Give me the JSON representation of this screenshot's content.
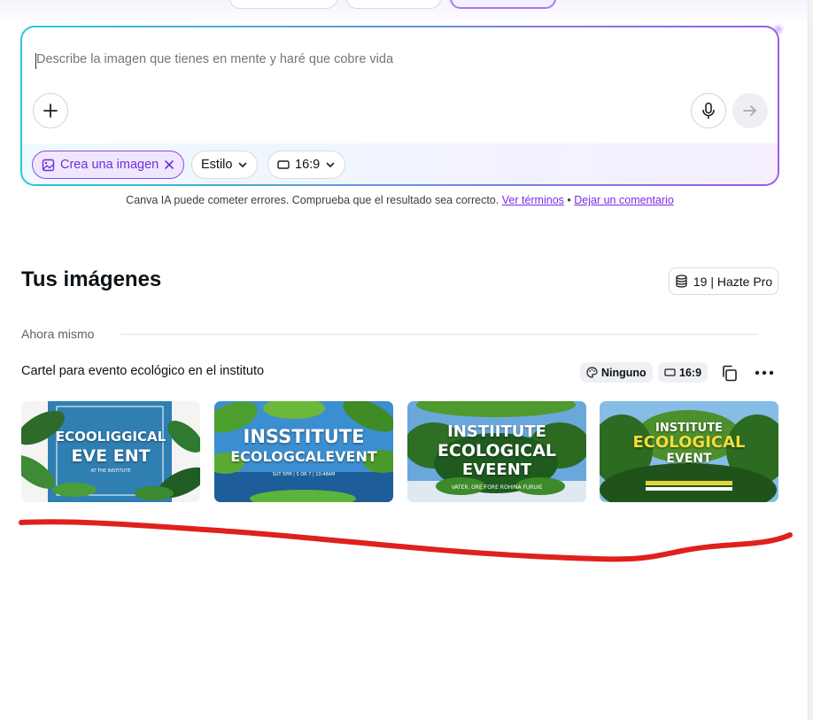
{
  "prompt": {
    "placeholder": "Describe la imagen que tienes en mente y haré que cobre vida",
    "chips": {
      "mode": "Crea una imagen",
      "style": "Estilo",
      "ratio": "16:9"
    }
  },
  "disclaimer": {
    "text": "Canva IA puede cometer errores. Comprueba que el resultado sea correcto.",
    "terms_link": "Ver términos",
    "separator": "•",
    "feedback_link": "Dejar un comentario"
  },
  "images_section": {
    "title": "Tus imágenes",
    "credits": "19 | Hazte Pro",
    "time_label": "Ahora mismo",
    "prompt_text": "Cartel para evento ecológico en el instituto",
    "style_tag": "Ninguno",
    "ratio_tag": "16:9",
    "thumbnails": [
      {
        "title_lines": [
          "ECOOLIGGICAL",
          "EVE ENT"
        ],
        "sub": "AT THE INSTITUTE"
      },
      {
        "title_lines": [
          "INSSTITUTE",
          "ECOLOGCALEVENT"
        ],
        "sub": "SUT 5PM | 5 OR 7 | 10:48AM"
      },
      {
        "title_lines": [
          "INSTIITUTE",
          "ECOLOGICAL",
          "EVEENT"
        ],
        "sub": "VATER. ORE FORE ROHINA FURUIE"
      },
      {
        "title_lines": [
          "INSTITUTE",
          "ECOLOGICAL",
          "EVENT"
        ],
        "sub": ""
      }
    ]
  },
  "colors": {
    "accent": "#7d2ae8",
    "annotation_red": "#e0201b"
  }
}
